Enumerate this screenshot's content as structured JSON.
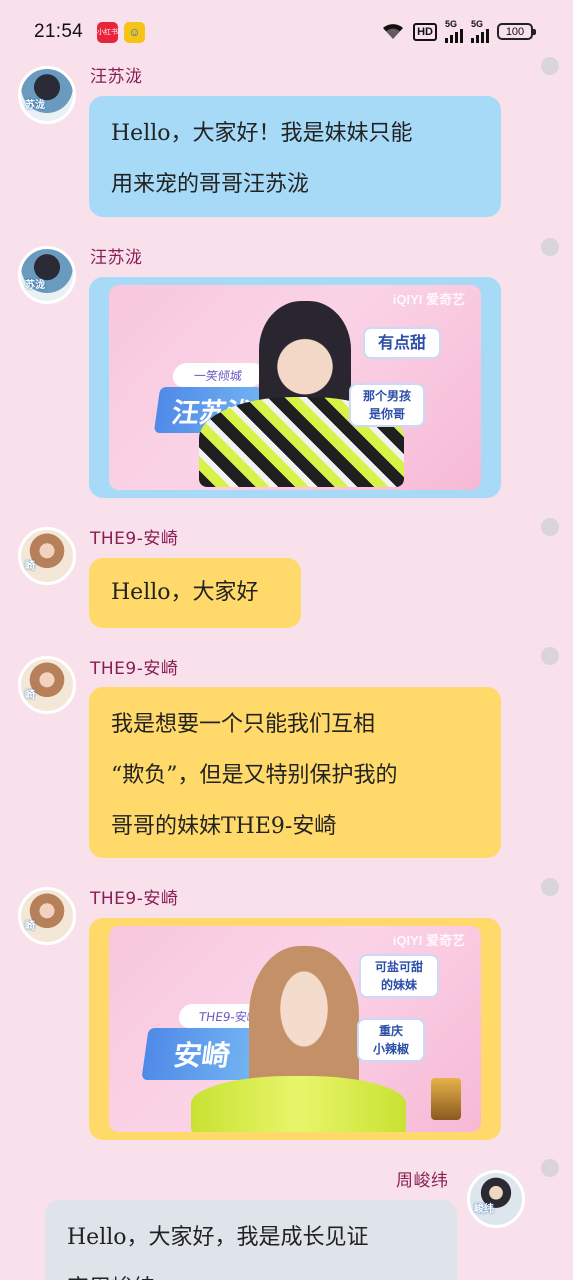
{
  "status_bar": {
    "time": "21:54",
    "app_icon_1": "小红书",
    "app_icon_2": "☺",
    "hd": "HD",
    "net1": "5G",
    "net2": "5G",
    "battery": "100"
  },
  "messages": [
    {
      "sender": "汪苏泷",
      "avatar_text": "苏泷",
      "lines": [
        "Hello，大家好！我是妹妹只能",
        "用来宠的哥哥汪苏泷"
      ]
    },
    {
      "sender": "汪苏泷",
      "avatar_text": "苏泷",
      "image": {
        "tag_small": "一笑倾城",
        "tag_main": "汪苏泷",
        "bubble_1": "有点甜",
        "bubble_2": "那个男孩\n是你哥",
        "watermark": "iQIYI 爱奇艺"
      }
    },
    {
      "sender": "THE9-安崎",
      "avatar_text": "崎",
      "lines": [
        "Hello，大家好"
      ]
    },
    {
      "sender": "THE9-安崎",
      "avatar_text": "崎",
      "lines": [
        "我是想要一个只能我们互相",
        "“欺负”，但是又特别保护我的",
        "哥哥的妹妹THE9-安崎"
      ]
    },
    {
      "sender": "THE9-安崎",
      "avatar_text": "崎",
      "image": {
        "tag_small": "THE9-安崎",
        "tag_main": "安崎",
        "bubble_1": "可盐可甜\n的妹妹",
        "bubble_2": "重庆\n小辣椒",
        "watermark": "iQIYI 爱奇艺"
      }
    },
    {
      "sender": "周峻纬",
      "avatar_text": "峻纬",
      "lines": [
        "Hello，大家好，我是成长见证",
        "官周峻纬"
      ]
    }
  ],
  "colors": {
    "background": "#f9e1ec",
    "name": "#8a1d55",
    "bubble_blue": "#a6daf6",
    "bubble_yellow": "#ffd96a",
    "bubble_grey": "#dfe3ea"
  }
}
